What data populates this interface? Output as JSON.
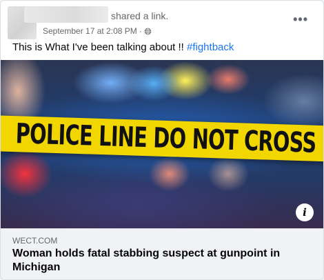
{
  "post": {
    "action_text": "shared a link.",
    "timestamp": "September 17 at 2:08 PM",
    "separator": "·",
    "privacy_icon": "globe-icon",
    "more_label": "•••",
    "text_body": "This is What I've been talking about !! ",
    "hashtag": "#fightback"
  },
  "link_preview": {
    "image_text": "POLICE LINE DO NOT CROSS",
    "info_label": "i",
    "domain": "WECT.COM",
    "headline": "Woman holds fatal stabbing suspect at gunpoint in Michigan"
  },
  "colors": {
    "link_blue": "#1877f2",
    "tape_yellow": "#f1d600",
    "footer_bg": "#f0f2f5"
  }
}
